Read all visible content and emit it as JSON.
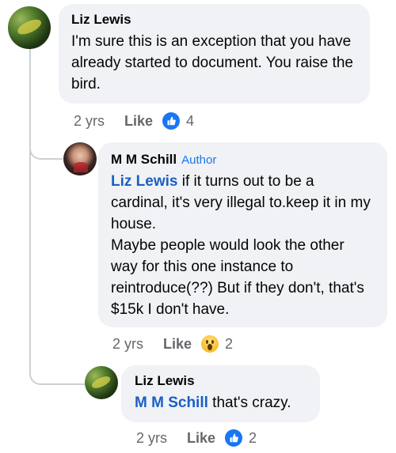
{
  "comments": [
    {
      "author": "Liz Lewis",
      "text": "I'm sure this is an exception that you have already started to document. You raise the bird.",
      "time": "2 yrs",
      "like_label": "Like",
      "reaction": "like-icon",
      "reaction_count": "4"
    },
    {
      "author": "M M Schill",
      "badge": "Author",
      "mention": "Liz Lewis",
      "text": " if it turns out to be a cardinal,  it's very illegal to.keep it in my house.",
      "text2": "Maybe people would look the other way for this one instance to reintroduce(??) But if they don't, that's $15k I don't have.",
      "time": "2 yrs",
      "like_label": "Like",
      "reaction": "wow-icon",
      "reaction_count": "2"
    },
    {
      "author": "Liz Lewis",
      "mention": "M M Schill",
      "text": " that's crazy.",
      "time": "2 yrs",
      "like_label": "Like",
      "reaction": "like-icon",
      "reaction_count": "2"
    }
  ],
  "colors": {
    "bubble": "#f0f2f5",
    "mention": "#1a5fc4",
    "badge": "#1877f2",
    "muted": "#65676b",
    "like_reaction": "#1877f2",
    "wow_reaction": "#f7b928"
  }
}
